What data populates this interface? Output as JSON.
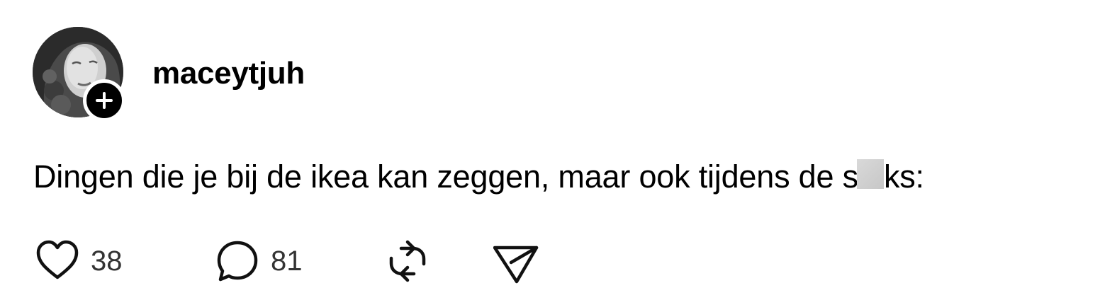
{
  "post": {
    "username": "maceytjuh",
    "text_before_censor": "Dingen die je bij de ikea kan zeggen, maar ook tijdens de s",
    "text_after_censor": "ks:",
    "likes": "38",
    "comments": "81"
  },
  "icons": {
    "follow": "plus-icon",
    "like": "heart-icon",
    "comment": "comment-bubble-icon",
    "repost": "repost-icon",
    "share": "send-icon"
  },
  "colors": {
    "text": "#000000",
    "count_text": "#333333",
    "censor": "#d0d0d0",
    "background": "#ffffff"
  }
}
